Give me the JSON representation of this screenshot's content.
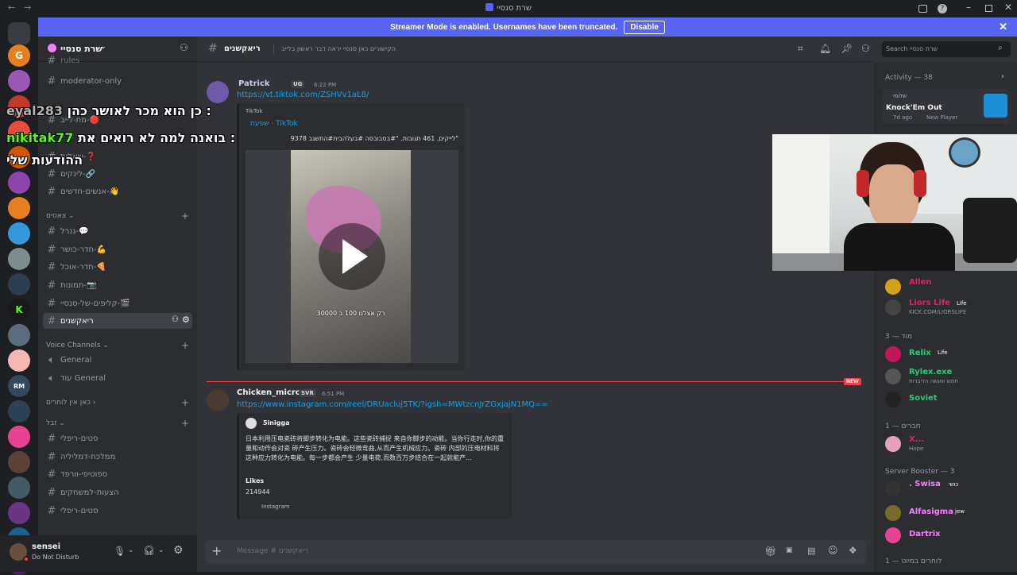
{
  "titlebar": {
    "title": "שרת סנסיי",
    "back": "←",
    "forward": "→"
  },
  "banner": {
    "text": "Streamer Mode is enabled. Usernames have been truncated.",
    "disable_label": "Disable",
    "close": "✕"
  },
  "server": {
    "name": "שרת סנסיי"
  },
  "channels": {
    "top_partial": "rules",
    "items_top": [
      {
        "label": "moderator-only"
      },
      {
        "label": "מת-לייב-🔴"
      },
      {
        "label": "שאלות-❓"
      },
      {
        "label": "לינקים-🔗"
      },
      {
        "label": "אנשים-חדשים-👋"
      }
    ],
    "category_chat": "צאטים",
    "items_chat": [
      {
        "label": "גנרל-💬"
      },
      {
        "label": "חדר-כושר-💪"
      },
      {
        "label": "חדר-אוכל-🍕"
      },
      {
        "label": "תמונות-📷"
      },
      {
        "label": "קליפים-של-סנסיי-🎬"
      },
      {
        "label": "ריאקשנים"
      }
    ],
    "category_voice": "Voice Channels",
    "voice": [
      {
        "label": "General"
      },
      {
        "label": "עוד General"
      }
    ],
    "category_none": "כאן אין לוחרים",
    "category_zbl": "זבל",
    "items_zbl": [
      {
        "label": "סטים-ריפלי"
      },
      {
        "label": "ממלכת-דמליליה"
      },
      {
        "label": "ספוטיפי-וורפד"
      },
      {
        "label": "הצעות-למשחקים"
      },
      {
        "label": "סטים-ריפלי"
      }
    ]
  },
  "user": {
    "name": "sensei",
    "status": "Do Not Disturb"
  },
  "header": {
    "channel": "ריאקשנים",
    "topic": "הקישורים כאן סנסיי יראה דבר ראשון בלייב",
    "search_placeholder": "Search שרת סנסיי"
  },
  "messages": [
    {
      "author": "Patrick",
      "tag": "UG",
      "time": "6:22 PM",
      "link": "https://vt.tiktok.com/ZSHVv1aL8/",
      "embed": {
        "provider": "TikTok",
        "title": "שפעת · TikTok",
        "description": "9378 לייקים, 461 תגובות. \"#בסבובסה #בעלהבית#התשגב\"",
        "video_caption": "רק אצלנו 100 ב 30000"
      }
    },
    {
      "author": "Chicken_micro",
      "tag": "SVR",
      "time": "6:51 PM",
      "new_badge": "NEW",
      "link": "https://www.instagram.com/reel/DRUacluj5TK/?igsh=MWtzcnJrZGxjajN1MQ==",
      "embed": {
        "author": "5inigga",
        "description": "日本利用压电瓷砖将脚步转化为电能。这些瓷砖捕捉 来自你脚步的动能。当你行走时,你的重量和动作会对瓷 砖产生压力。瓷砖会轻微弯曲,从而产生机械应力。瓷砖 内部的压电材料将这种应力转化为电能。每一步都会产生 少量电荷,而数百万步结合在一起就能产...",
        "field_name": "Likes",
        "field_value": "214944",
        "footer": "Instagram"
      }
    }
  ],
  "composer": {
    "placeholder": "Message # ריאקשנים"
  },
  "members": {
    "activity": {
      "label": "Activity — 38",
      "user": "שלומי",
      "game": "Knock'Em Out",
      "time": "7d ago",
      "tag": "New Player"
    },
    "list": [
      {
        "name": "Allen",
        "color": "#e91e63"
      },
      {
        "name": "Liors Life",
        "badge": "Life",
        "sub": "KICK.COM/LIORSLIFE",
        "color": "#e91e63"
      }
    ],
    "group_mod": "מוד — 3",
    "mods": [
      {
        "name": "Relix",
        "badge": "Life",
        "color": "#2ecc71"
      },
      {
        "name": "Rylex.exe",
        "sub": "חמש שעשה הדיברות",
        "color": "#2ecc71"
      },
      {
        "name": "Soviet",
        "color": "#2ecc71"
      }
    ],
    "group_friends": "חברים — 1",
    "friends": [
      {
        "name": "X...",
        "sub": "Hope",
        "color": "#e91e63"
      }
    ],
    "group_boost": "Server Booster — 3",
    "boosters": [
      {
        "name": ". Swisa",
        "badge": "כושי",
        "color": "#f47fff"
      },
      {
        "name": "Alfasigma",
        "badge": "jew",
        "color": "#f47fff"
      },
      {
        "name": "Dartrix",
        "color": "#f47fff"
      }
    ],
    "group_last": "לוחרים במיוט — 1"
  },
  "overlays": {
    "line1_user": "eyal283",
    "line1_text": "כן הוא מכר לאושר כהן :",
    "line2_user": "nikitak77",
    "line2_text": "בואנה למה לא רואים את :",
    "line3_text": "ההודעות שלי"
  },
  "colors": {
    "accent": "#5865f2",
    "link": "#00a8fc",
    "new": "#f23f43"
  }
}
